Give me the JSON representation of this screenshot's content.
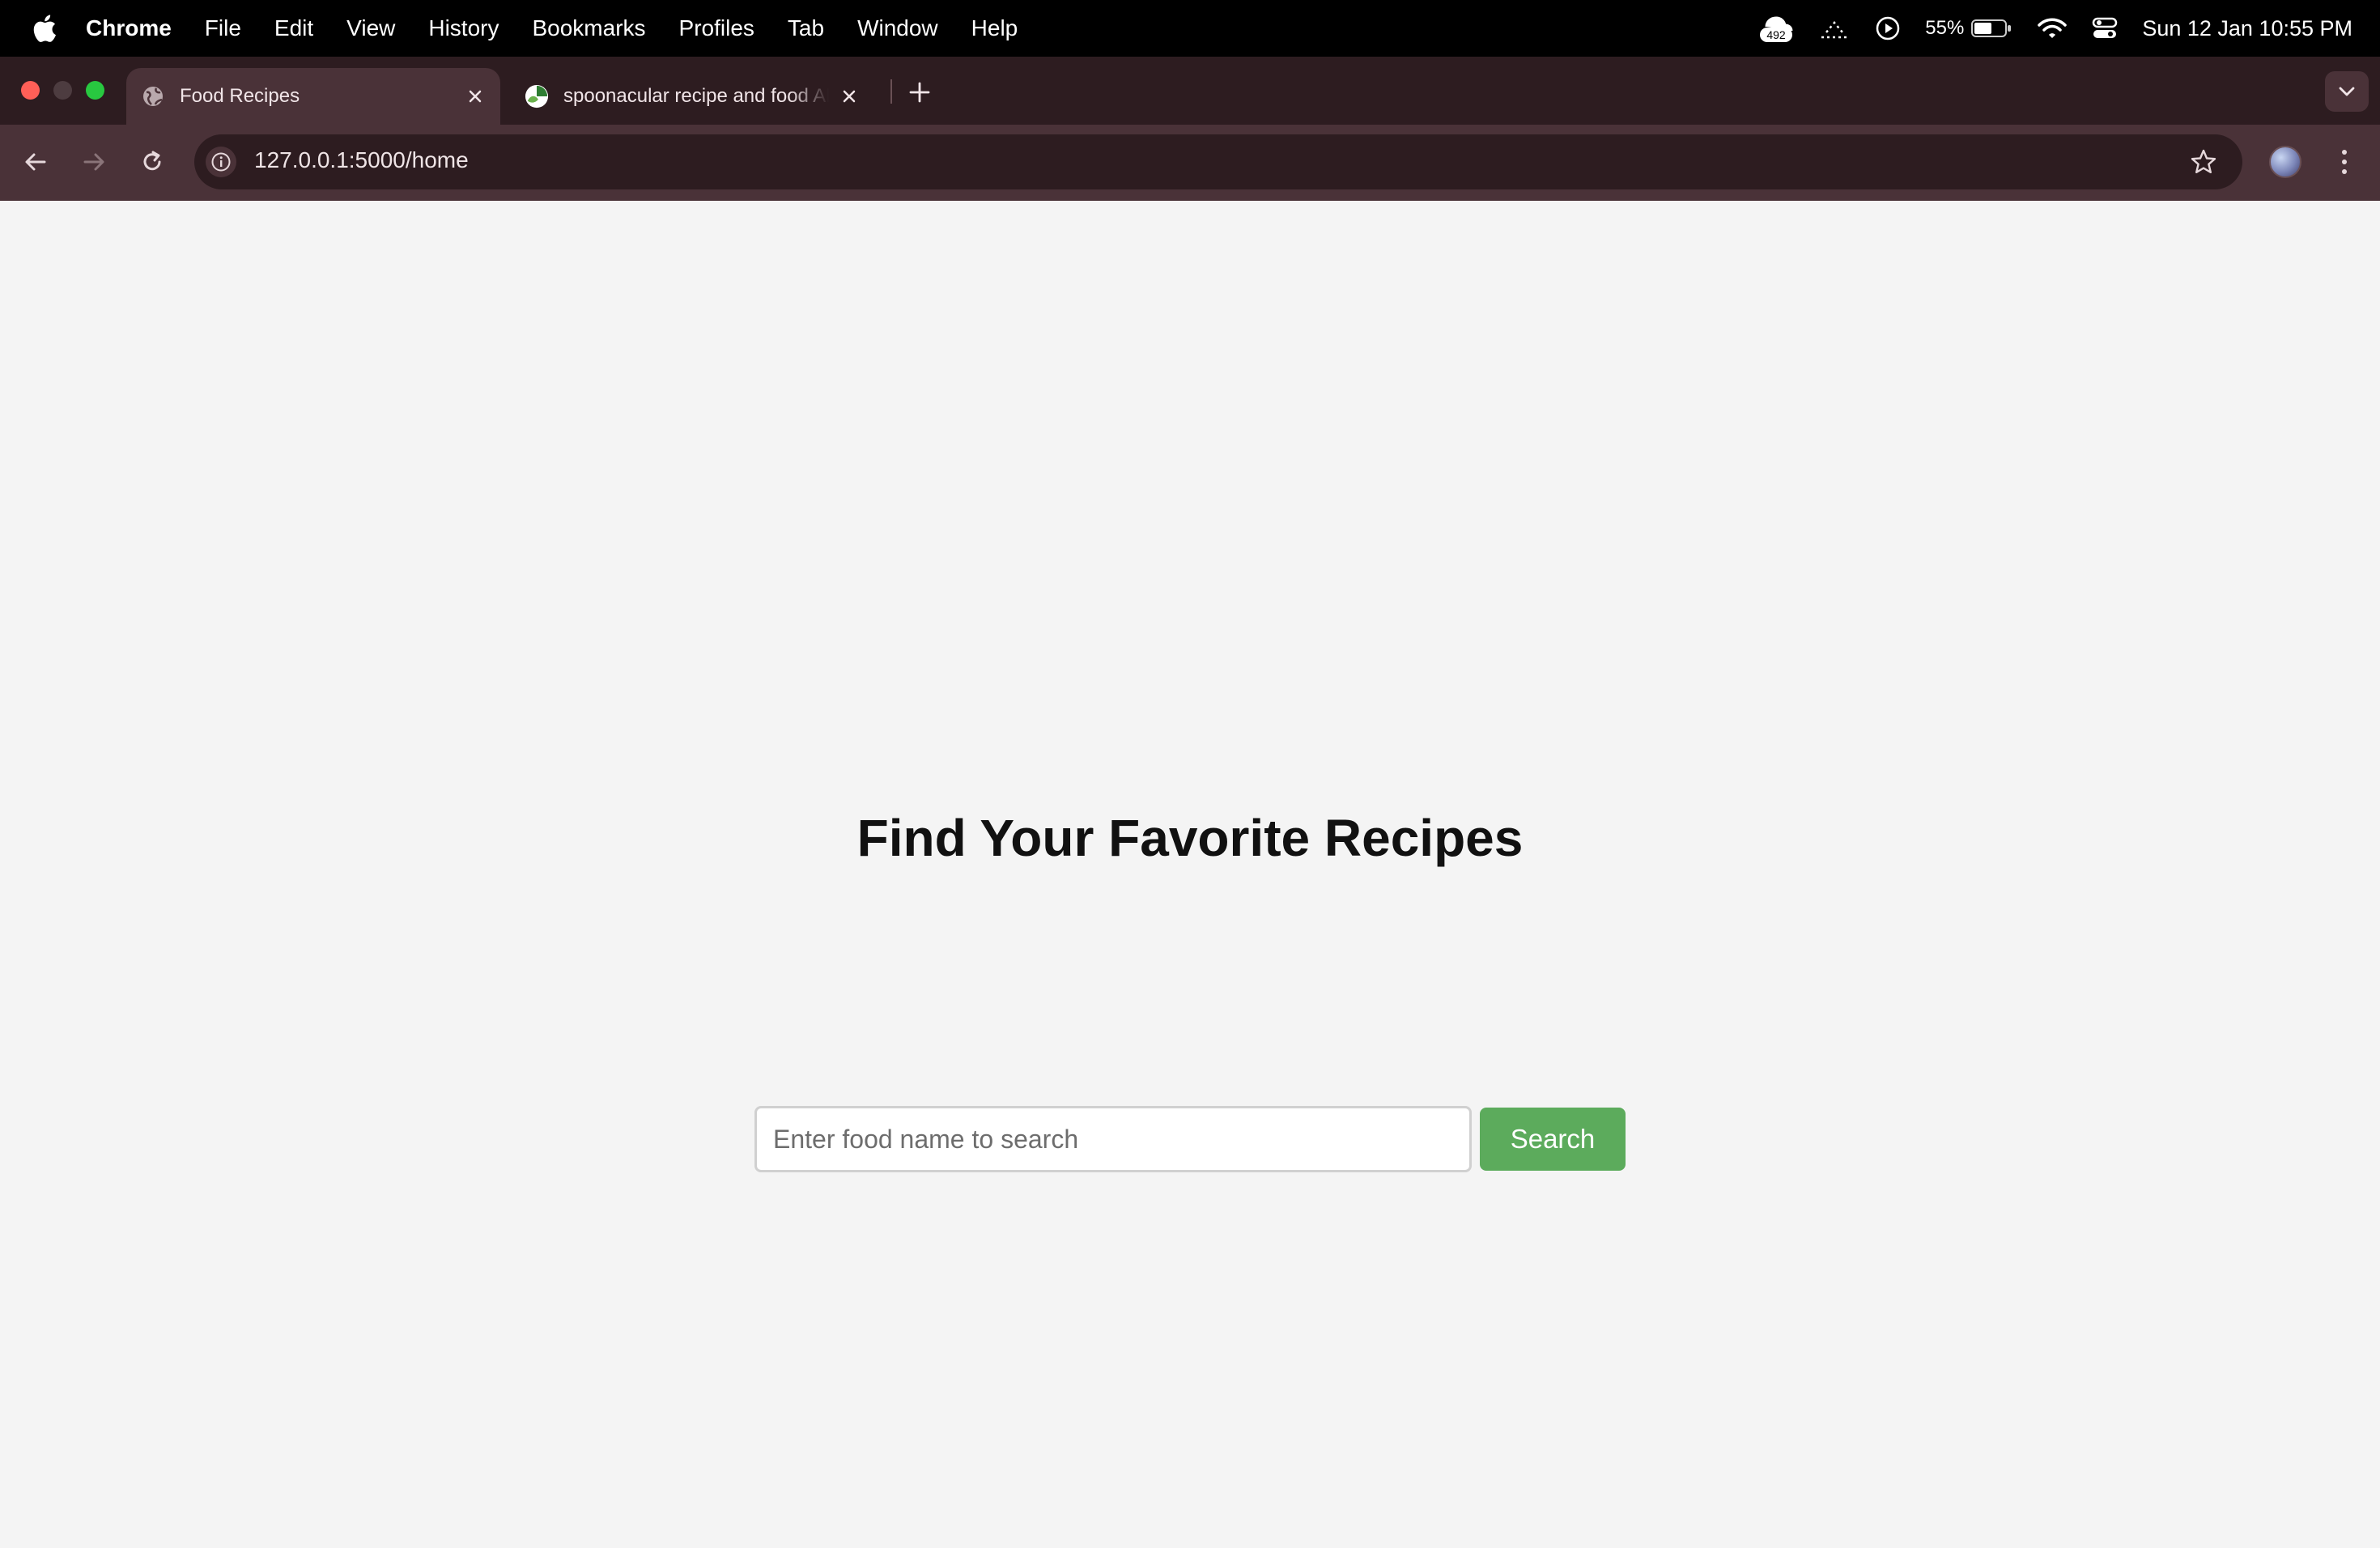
{
  "menubar": {
    "app_name": "Chrome",
    "items": [
      "File",
      "Edit",
      "View",
      "History",
      "Bookmarks",
      "Profiles",
      "Tab",
      "Window",
      "Help"
    ],
    "status": {
      "cloud_badge": "492",
      "battery": "55%",
      "datetime": "Sun 12 Jan  10:55 PM"
    }
  },
  "browser": {
    "tabs": [
      {
        "title": "Food Recipes",
        "active": true
      },
      {
        "title": "spoonacular recipe and food API",
        "active": false
      }
    ],
    "url": "127.0.0.1:5000/home"
  },
  "page": {
    "heading": "Find Your Favorite Recipes",
    "search": {
      "placeholder": "Enter food name to search",
      "value": "",
      "button_label": "Search"
    }
  },
  "colors": {
    "accent_button": "#5cab5c",
    "page_background": "#f4f4f4",
    "browser_frame": "#4a3238"
  }
}
